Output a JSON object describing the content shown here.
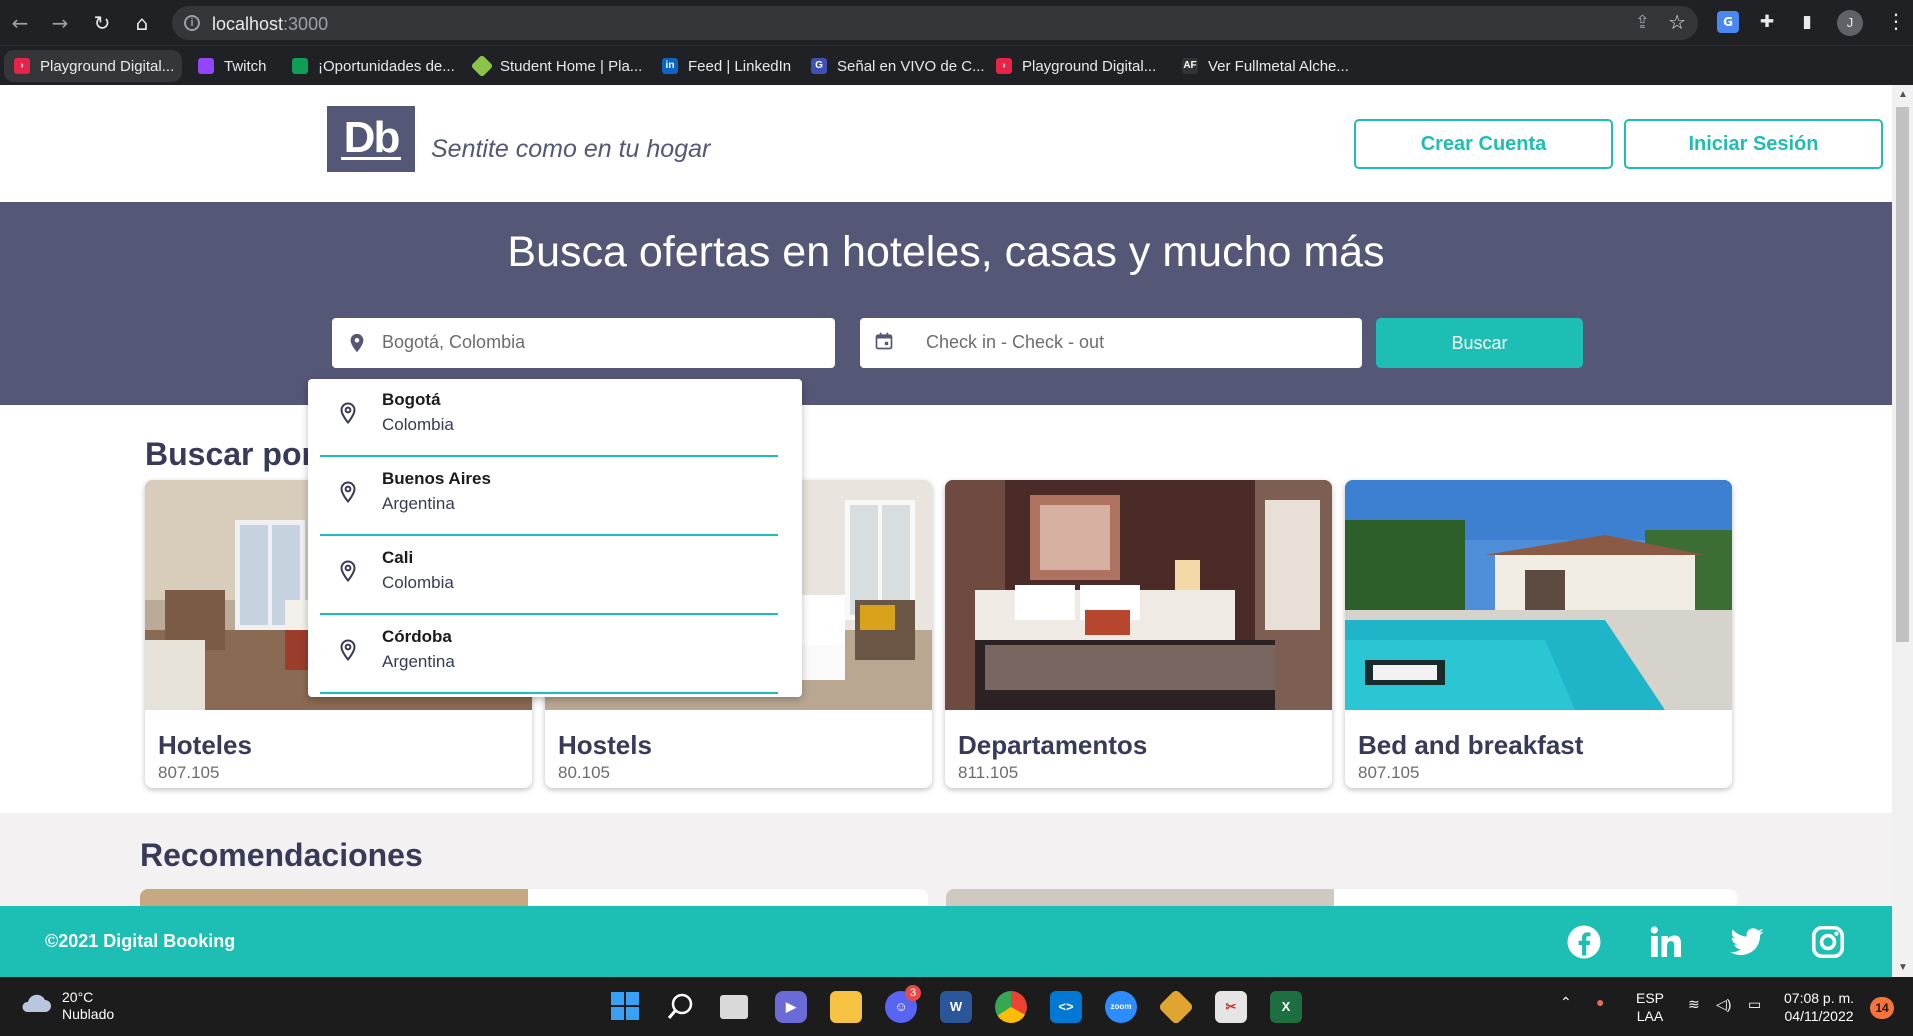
{
  "browser": {
    "url_host": "localhost",
    "url_port": ":3000",
    "profile_initial": "J",
    "bookmarks": [
      {
        "label": "Playground Digital...",
        "color": "#e8234a"
      },
      {
        "label": "Twitch",
        "color": "#9146ff"
      },
      {
        "label": "¡Oportunidades de...",
        "color": "#0f9d58"
      },
      {
        "label": "Student Home | Pla...",
        "color": "#8bc34a"
      },
      {
        "label": "Feed | LinkedIn",
        "color": "#0a66c2"
      },
      {
        "label": "Señal en VIVO de C...",
        "color": "#3f51b5"
      },
      {
        "label": "Playground Digital...",
        "color": "#e8234a"
      },
      {
        "label": "Ver Fullmetal Alche...",
        "color": "#333333"
      }
    ]
  },
  "header": {
    "logo_text": "Db",
    "slogan": "Sentite como en tu hogar",
    "create_account": "Crear Cuenta",
    "login": "Iniciar Sesión"
  },
  "hero": {
    "title": "Busca ofertas en hoteles, casas y mucho más",
    "location_value": "Bogotá, Colombia",
    "dates_placeholder": "Check in - Check - out",
    "search_button": "Buscar"
  },
  "dropdown": [
    {
      "city": "Bogotá",
      "country": "Colombia"
    },
    {
      "city": "Buenos Aires",
      "country": "Argentina"
    },
    {
      "city": "Cali",
      "country": "Colombia"
    },
    {
      "city": "Córdoba",
      "country": "Argentina"
    }
  ],
  "categories": {
    "title": "Buscar por tipo de alojamiento",
    "items": [
      {
        "name": "Hoteles",
        "count": "807.105"
      },
      {
        "name": "Hostels",
        "count": "80.105"
      },
      {
        "name": "Departamentos",
        "count": "811.105"
      },
      {
        "name": "Bed and breakfast",
        "count": "807.105"
      }
    ]
  },
  "recommendations": {
    "title": "Recomendaciones"
  },
  "footer": {
    "copyright": "©2021 Digital Booking"
  },
  "taskbar": {
    "temp": "20°C",
    "weather": "Nublado",
    "discord_badge": "3",
    "lang_top": "ESP",
    "lang_bottom": "LAA",
    "time": "07:08 p. m.",
    "date": "04/11/2022",
    "notifications": "14"
  }
}
